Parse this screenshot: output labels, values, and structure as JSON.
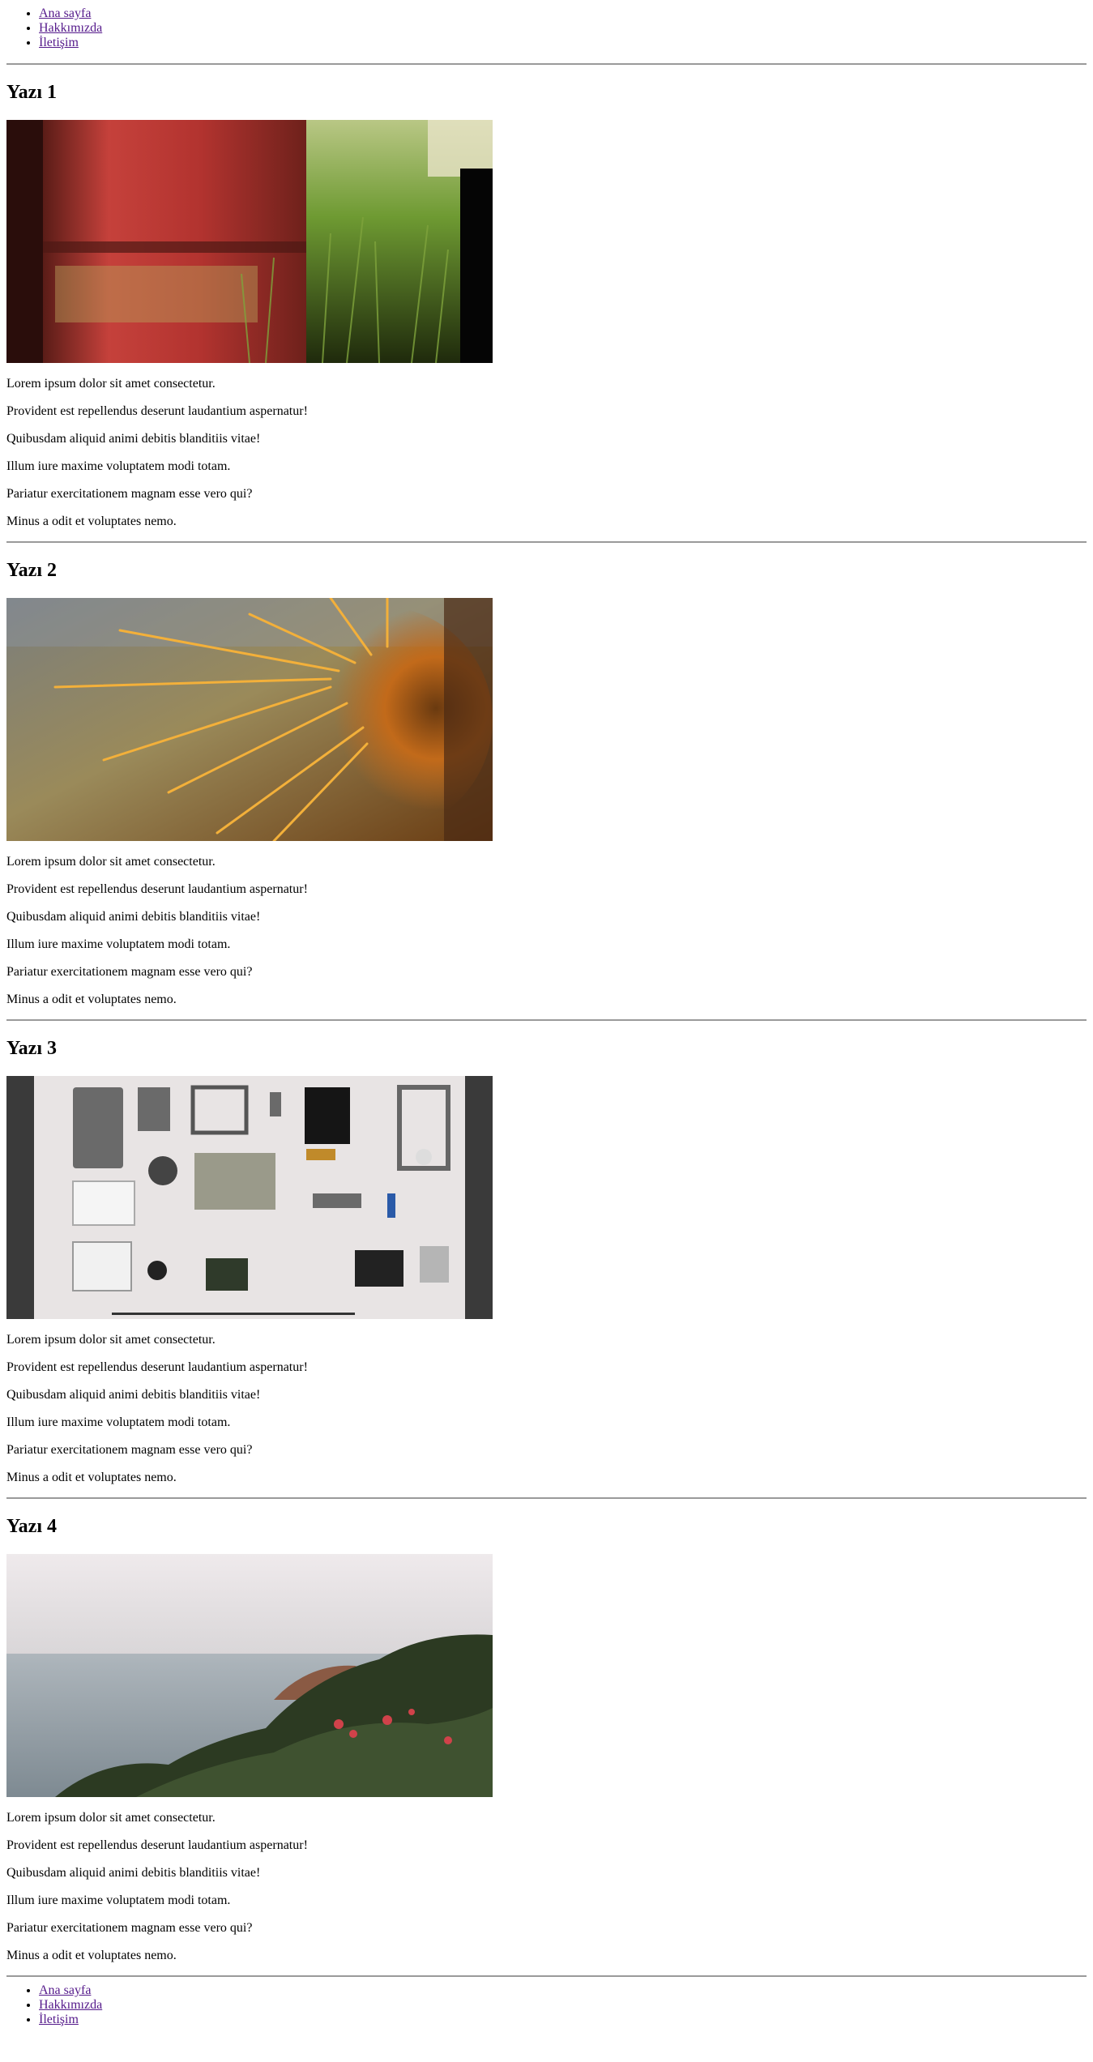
{
  "nav": {
    "items": [
      {
        "label": "Ana sayfa"
      },
      {
        "label": "Hakkımızda"
      },
      {
        "label": "İletişim"
      }
    ]
  },
  "posts": [
    {
      "title": "Yazı 1",
      "image_icon": "rusty-barrel-photo",
      "paragraphs": [
        "Lorem ipsum dolor sit amet consectetur.",
        "Provident est repellendus deserunt laudantium aspernatur!",
        "Quibusdam aliquid animi debitis blanditiis vitae!",
        "Illum iure maxime voluptatem modi totam.",
        "Pariatur exercitationem magnam esse vero qui?",
        "Minus a odit et voluptates nemo."
      ]
    },
    {
      "title": "Yazı 2",
      "image_icon": "cactus-photo",
      "paragraphs": [
        "Lorem ipsum dolor sit amet consectetur.",
        "Provident est repellendus deserunt laudantium aspernatur!",
        "Quibusdam aliquid animi debitis blanditiis vitae!",
        "Illum iure maxime voluptatem modi totam.",
        "Pariatur exercitationem magnam esse vero qui?",
        "Minus a odit et voluptates nemo."
      ]
    },
    {
      "title": "Yazı 3",
      "image_icon": "disassembled-camera-photo",
      "paragraphs": [
        "Lorem ipsum dolor sit amet consectetur.",
        "Provident est repellendus deserunt laudantium aspernatur!",
        "Quibusdam aliquid animi debitis blanditiis vitae!",
        "Illum iure maxime voluptatem modi totam.",
        "Pariatur exercitationem magnam esse vero qui?",
        "Minus a odit et voluptates nemo."
      ]
    },
    {
      "title": "Yazı 4",
      "image_icon": "seaside-cliff-photo",
      "paragraphs": [
        "Lorem ipsum dolor sit amet consectetur.",
        "Provident est repellendus deserunt laudantium aspernatur!",
        "Quibusdam aliquid animi debitis blanditiis vitae!",
        "Illum iure maxime voluptatem modi totam.",
        "Pariatur exercitationem magnam esse vero qui?",
        "Minus a odit et voluptates nemo."
      ]
    }
  ],
  "footer_nav": {
    "items": [
      {
        "label": "Ana sayfa"
      },
      {
        "label": "Hakkımızda"
      },
      {
        "label": "İletişim"
      }
    ]
  },
  "colors": {
    "link": "#551a8b",
    "divider": "#9a9a9a",
    "text": "#000000",
    "background": "#ffffff"
  }
}
